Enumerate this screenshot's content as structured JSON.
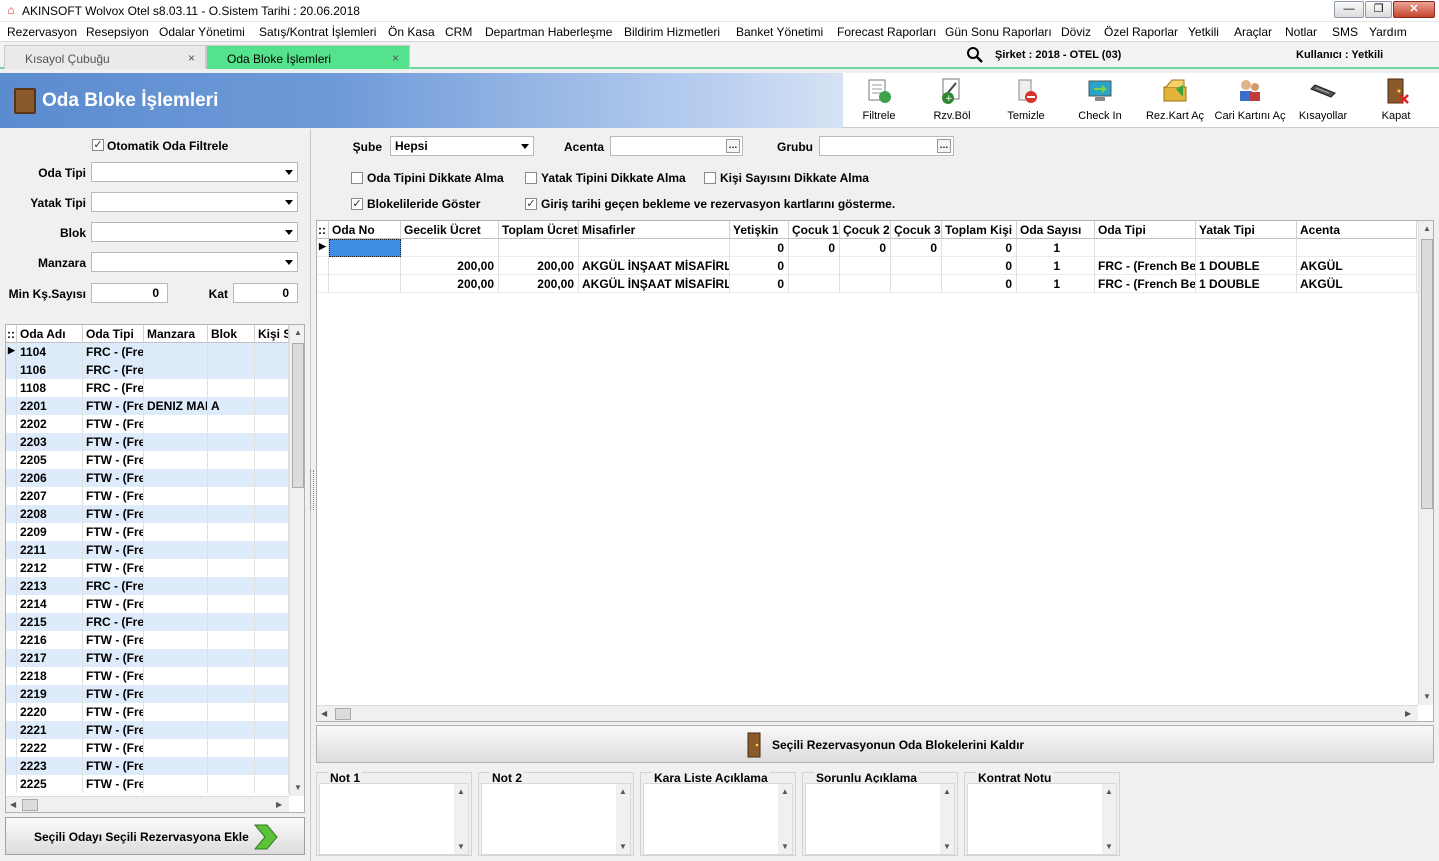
{
  "window": {
    "title": "AKINSOFT Wolvox Otel s8.03.11 - O.Sistem Tarihi : 20.06.2018",
    "min": "—",
    "max": "❐",
    "close": "✕"
  },
  "menu": [
    "Rezervasyon",
    "Resepsiyon",
    "Odalar Yönetimi",
    "Satış/Kontrat İşlemleri",
    "Ön Kasa",
    "CRM",
    "Departman Haberleşme",
    "Bildirim Hizmetleri",
    "Banket Yönetimi",
    "Forecast Raporları",
    "Gün Sonu Raporları",
    "Döviz",
    "Özel Raporlar",
    "Yetkili",
    "Araçlar",
    "Notlar",
    "SMS",
    "Yardım"
  ],
  "tabs": [
    {
      "label": "Kısayol Çubuğu",
      "close": "×"
    },
    {
      "label": "Oda Bloke İşlemleri",
      "close": "×"
    }
  ],
  "status": {
    "company": "Şirket : 2018 - OTEL (03)",
    "user": "Kullanıcı : Yetkili"
  },
  "page_title": "Oda Bloke İşlemleri",
  "toolbar": [
    {
      "label": "Filtrele",
      "icon": "filter-icon"
    },
    {
      "label": "Rzv.Böl",
      "icon": "split-reservation-icon"
    },
    {
      "label": "Temizle",
      "icon": "clear-icon"
    },
    {
      "label": "Check In",
      "icon": "check-in-icon"
    },
    {
      "label": "Rez.Kart Aç",
      "icon": "reservation-card-icon"
    },
    {
      "label": "Cari Kartını Aç",
      "icon": "account-card-icon"
    },
    {
      "label": "Kısayollar",
      "icon": "shortcuts-icon"
    },
    {
      "label": "Kapat",
      "icon": "close-door-icon"
    }
  ],
  "left": {
    "auto_filter": {
      "label": "Otomatik Oda Filtrele",
      "checked": true
    },
    "room_type": {
      "label": "Oda Tipi",
      "value": ""
    },
    "bed_type": {
      "label": "Yatak Tipi",
      "value": ""
    },
    "block": {
      "label": "Blok",
      "value": ""
    },
    "view": {
      "label": "Manzara",
      "value": ""
    },
    "min_persons": {
      "label": "Min Kş.Sayısı",
      "value": "0"
    },
    "floor": {
      "label": "Kat",
      "value": "0"
    },
    "columns": [
      "Oda Adı",
      "Oda Tipi",
      "Manzara",
      "Blok",
      "Kişi S"
    ],
    "rooms": [
      [
        "1104",
        "FRC - (French",
        "",
        "",
        ""
      ],
      [
        "1106",
        "FRC - (French",
        "",
        "",
        ""
      ],
      [
        "1108",
        "FRC - (French",
        "",
        "",
        ""
      ],
      [
        "2201",
        "FTW - (French",
        "DENIZ MANZ",
        "A",
        ""
      ],
      [
        "2202",
        "FTW - (French",
        "",
        "",
        ""
      ],
      [
        "2203",
        "FTW - (French",
        "",
        "",
        ""
      ],
      [
        "2205",
        "FTW - (French",
        "",
        "",
        ""
      ],
      [
        "2206",
        "FTW - (French",
        "",
        "",
        ""
      ],
      [
        "2207",
        "FTW - (French",
        "",
        "",
        ""
      ],
      [
        "2208",
        "FTW - (French",
        "",
        "",
        ""
      ],
      [
        "2209",
        "FTW - (French",
        "",
        "",
        ""
      ],
      [
        "2211",
        "FTW - (French",
        "",
        "",
        ""
      ],
      [
        "2212",
        "FTW - (French",
        "",
        "",
        ""
      ],
      [
        "2213",
        "FRC - (French",
        "",
        "",
        ""
      ],
      [
        "2214",
        "FTW - (French",
        "",
        "",
        ""
      ],
      [
        "2215",
        "FRC - (French",
        "",
        "",
        ""
      ],
      [
        "2216",
        "FTW - (French",
        "",
        "",
        ""
      ],
      [
        "2217",
        "FTW - (French",
        "",
        "",
        ""
      ],
      [
        "2218",
        "FTW - (French",
        "",
        "",
        ""
      ],
      [
        "2219",
        "FTW - (French",
        "",
        "",
        ""
      ],
      [
        "2220",
        "FTW - (French",
        "",
        "",
        ""
      ],
      [
        "2221",
        "FTW - (French",
        "",
        "",
        ""
      ],
      [
        "2222",
        "FTW - (French",
        "",
        "",
        ""
      ],
      [
        "2223",
        "FTW - (French",
        "",
        "",
        ""
      ],
      [
        "2225",
        "FTW - (French",
        "",
        "",
        ""
      ]
    ],
    "add_button": "Seçili Odayı Seçili Rezervasyona Ekle"
  },
  "right": {
    "branch": {
      "label": "Şube",
      "value": "Hepsi"
    },
    "agency": {
      "label": "Acenta",
      "value": ""
    },
    "group": {
      "label": "Grubu",
      "value": ""
    },
    "checks": [
      {
        "label": "Oda Tipini Dikkate Alma",
        "checked": false
      },
      {
        "label": "Yatak Tipini Dikkate Alma",
        "checked": false
      },
      {
        "label": "Kişi Sayısını Dikkate Alma",
        "checked": false
      },
      {
        "label": "Blokelileride Göster",
        "checked": true
      },
      {
        "label": "Giriş tarihi geçen bekleme ve rezervasyon kartlarını gösterme.",
        "checked": true
      }
    ],
    "columns": [
      "Oda No",
      "Gecelik Ücret",
      "Toplam Ücret",
      "Misafirler",
      "Yetişkin",
      "Çocuk 1",
      "Çocuk 2",
      "Çocuk 3",
      "Toplam Kişi",
      "Oda Sayısı",
      "Oda Tipi",
      "Yatak Tipi",
      "Acenta"
    ],
    "rows": [
      [
        "",
        "",
        "",
        "",
        "0",
        "0",
        "0",
        "0",
        "0",
        "1",
        "",
        "",
        ""
      ],
      [
        "",
        "200,00",
        "200,00",
        "AKGÜL İNŞAAT MİSAFİRLERİ",
        "0",
        "",
        "",
        "",
        "0",
        "1",
        "FRC - (French Bed)",
        "1 DOUBLE",
        "AKGÜL"
      ],
      [
        "",
        "200,00",
        "200,00",
        "AKGÜL İNŞAAT MİSAFİRLERİ",
        "0",
        "",
        "",
        "",
        "0",
        "1",
        "FRC - (French Bed)",
        "1 DOUBLE",
        "AKGÜL"
      ]
    ],
    "remove_button": "Seçili Rezervasyonun Oda Blokelerini Kaldır",
    "notes": [
      "Not 1",
      "Not 2",
      "Kara Liste Açıklama",
      "Sorunlu Açıklama",
      "Kontrat Notu"
    ]
  }
}
